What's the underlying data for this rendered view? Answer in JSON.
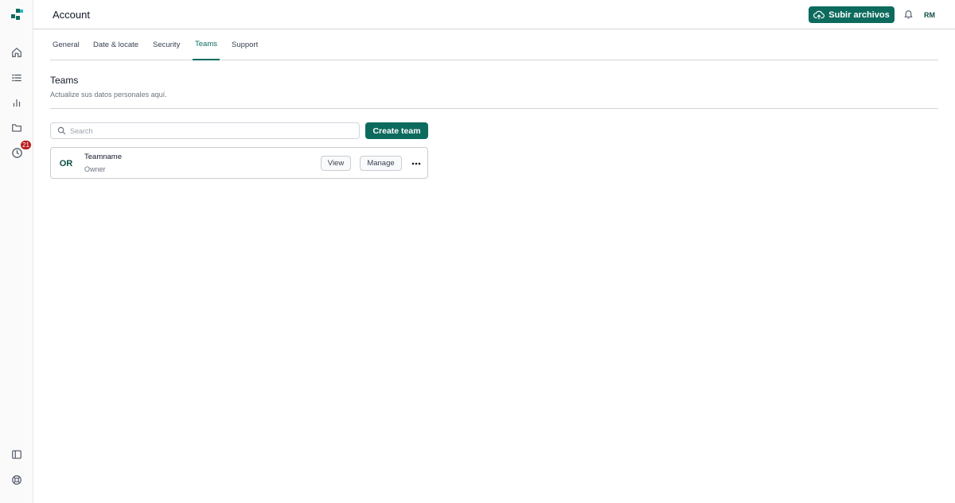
{
  "header": {
    "title": "Account",
    "upload_label": "Subir archivos",
    "user_initials": "RM"
  },
  "sidebar": {
    "badge_count": "21",
    "icons": [
      "home-icon",
      "list-icon",
      "chart-icon",
      "folder-icon",
      "clock-icon",
      "sidebar-toggle-icon",
      "help-icon"
    ]
  },
  "tabs": [
    {
      "label": "General",
      "active": false
    },
    {
      "label": "Date & locate",
      "active": false
    },
    {
      "label": "Security",
      "active": false
    },
    {
      "label": "Teams",
      "active": true
    },
    {
      "label": "Support",
      "active": false
    }
  ],
  "section": {
    "title": "Teams",
    "subtitle": "Actualize sus datos personales aquí."
  },
  "search": {
    "placeholder": "Search",
    "value": ""
  },
  "actions": {
    "create_team_label": "Create team"
  },
  "teams": [
    {
      "initials": "OR",
      "name": "Teamname",
      "role": "Owner",
      "view_label": "View",
      "manage_label": "Manage"
    }
  ],
  "colors": {
    "accent": "#0d6b5e",
    "badge": "#b91c1c"
  }
}
